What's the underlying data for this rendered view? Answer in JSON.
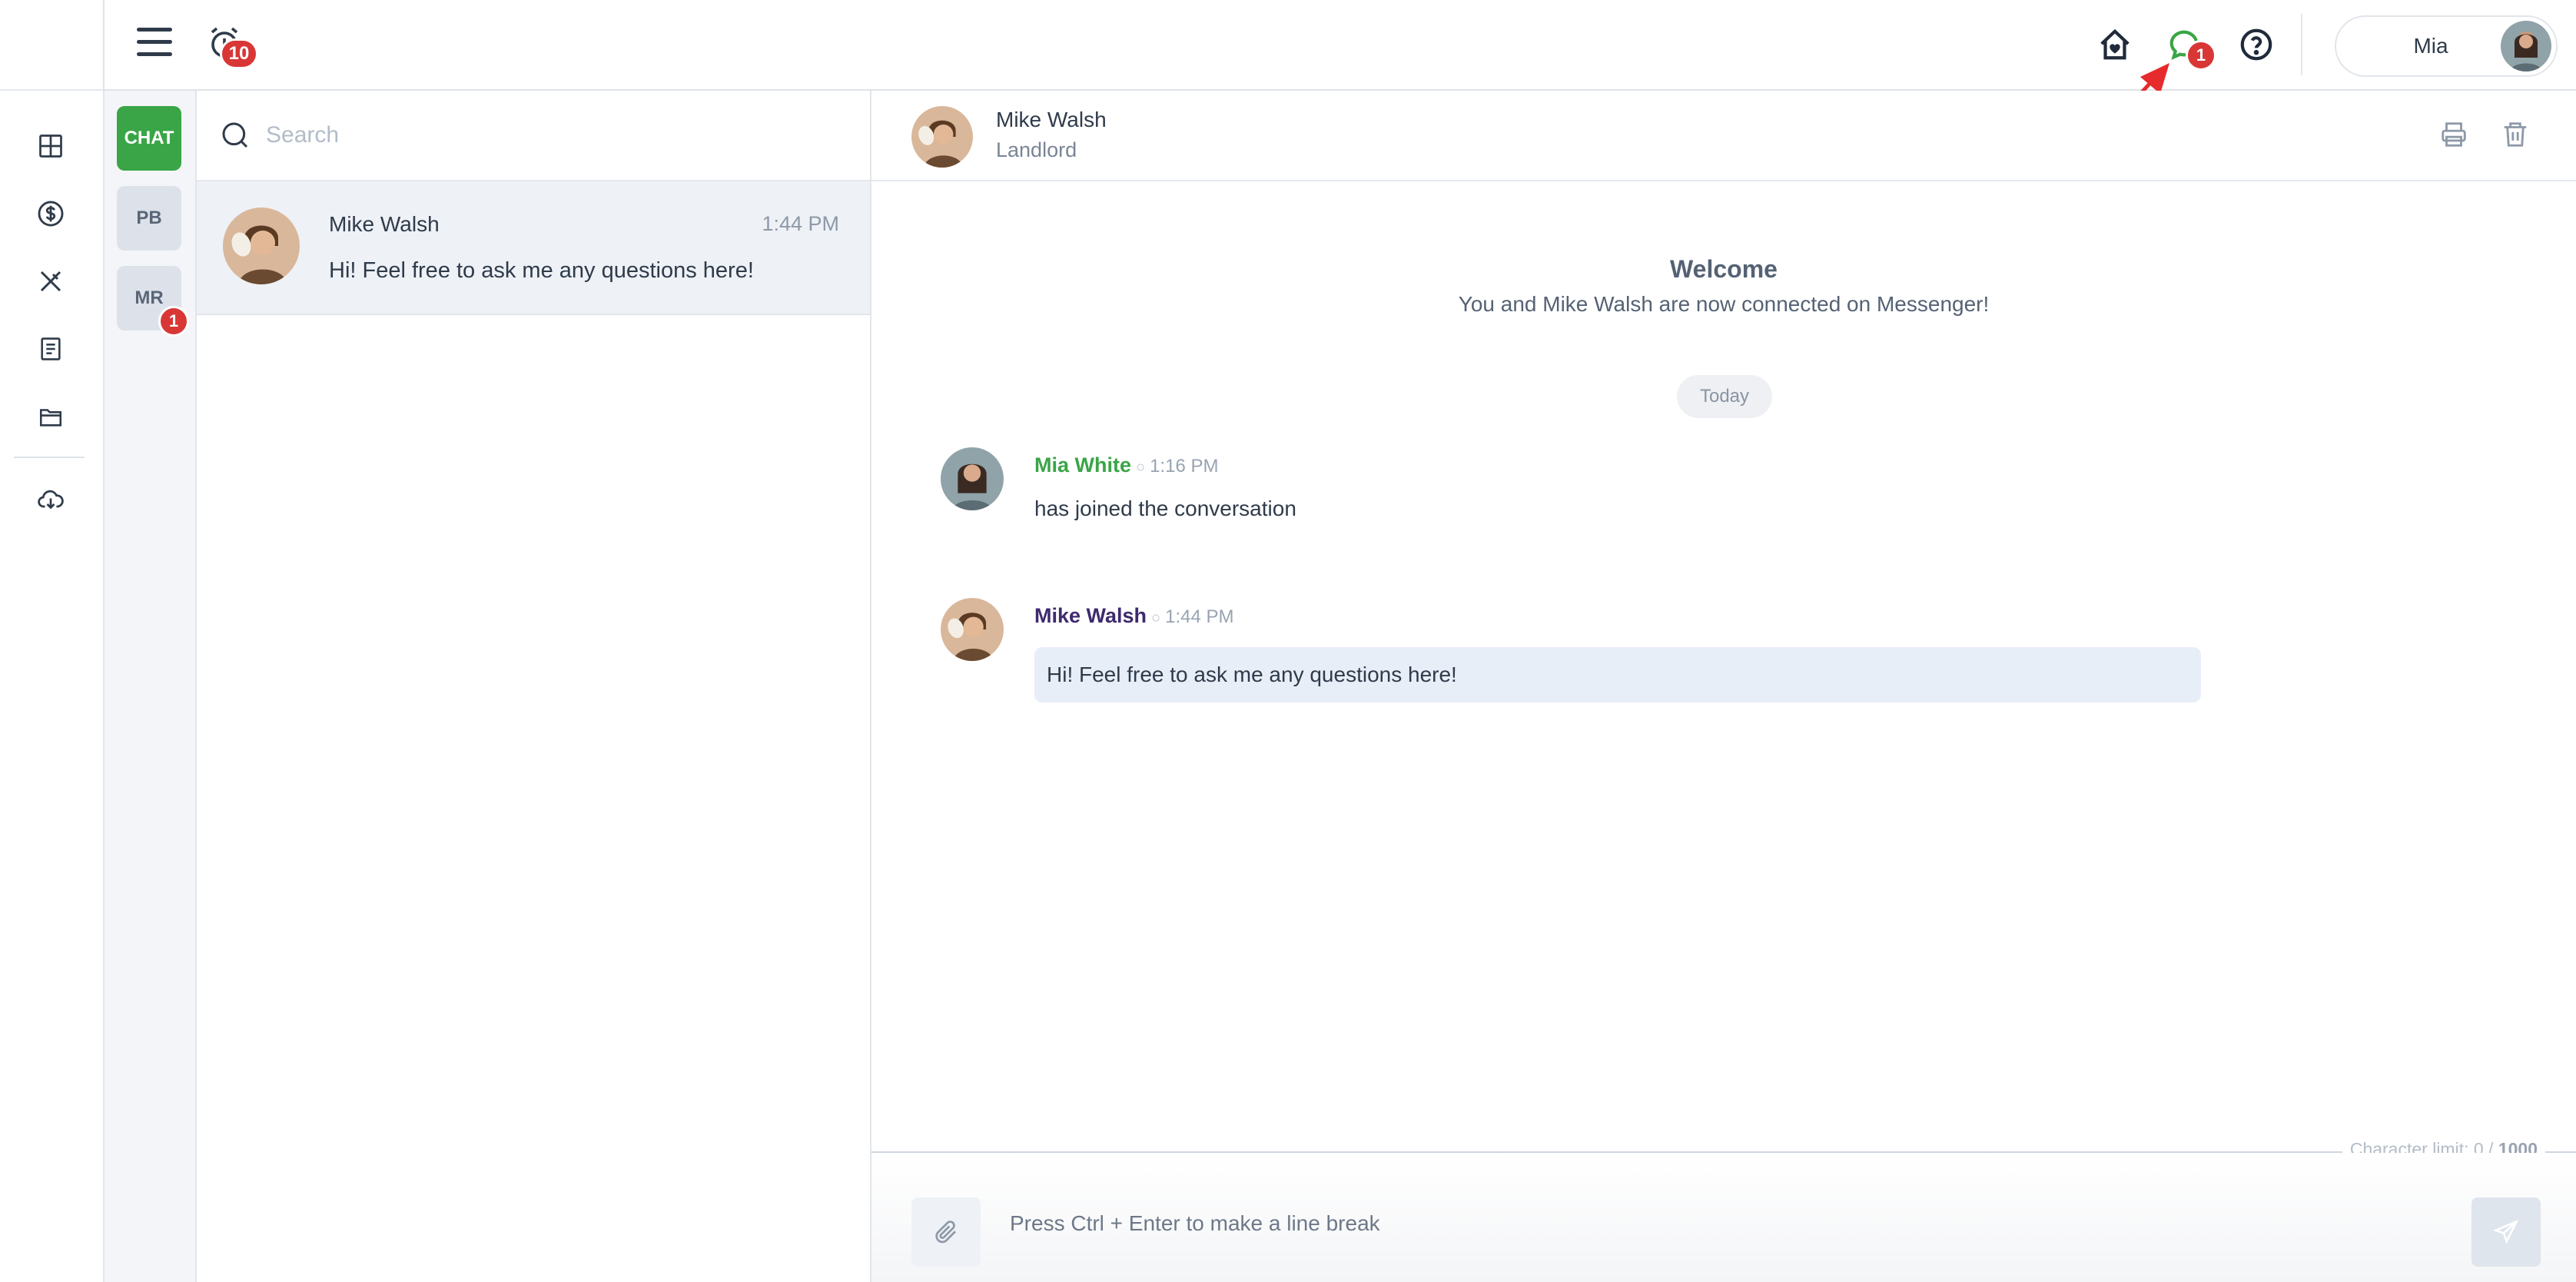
{
  "topbar": {
    "alarm_count": "10",
    "messages_count": "1",
    "user_name": "Mia"
  },
  "channels": [
    {
      "label": "CHAT",
      "active": true
    },
    {
      "label": "PB",
      "active": false
    },
    {
      "label": "MR",
      "active": false,
      "badge": "1"
    }
  ],
  "search": {
    "placeholder": "Search"
  },
  "conversations": [
    {
      "name": "Mike Walsh",
      "time": "1:44 PM",
      "preview": "Hi! Feel free to ask me any questions here!"
    }
  ],
  "chat": {
    "contact_name": "Mike Walsh",
    "contact_role": "Landlord",
    "welcome_title": "Welcome",
    "welcome_subtitle": "You and Mike Walsh are now connected on Messenger!",
    "date_divider": "Today",
    "messages": [
      {
        "sender": "Mia White",
        "time": "1:16 PM",
        "text": "has joined the conversation",
        "sender_color": "#3aa546"
      },
      {
        "sender": "Mike Walsh",
        "time": "1:44 PM",
        "text": "Hi! Feel free to ask me any questions here!",
        "sender_color": "#3e2a6e"
      }
    ],
    "char_limit_label": "Character limit: 0 /",
    "char_limit_max": "1000",
    "composer_placeholder": "Press Ctrl + Enter to make a line break"
  },
  "colors": {
    "accent_green": "#3aa546",
    "badge_red": "#d93636",
    "bubble_bg": "#e8eef8"
  },
  "icons": {
    "rail": [
      "dashboard-icon",
      "dollar-icon",
      "tools-icon",
      "document-icon",
      "folder-icon",
      "cloud-download-icon"
    ],
    "topbar": [
      "home-heart-icon",
      "chat-bubble-icon",
      "help-icon"
    ],
    "header": [
      "print-icon",
      "trash-icon"
    ]
  }
}
